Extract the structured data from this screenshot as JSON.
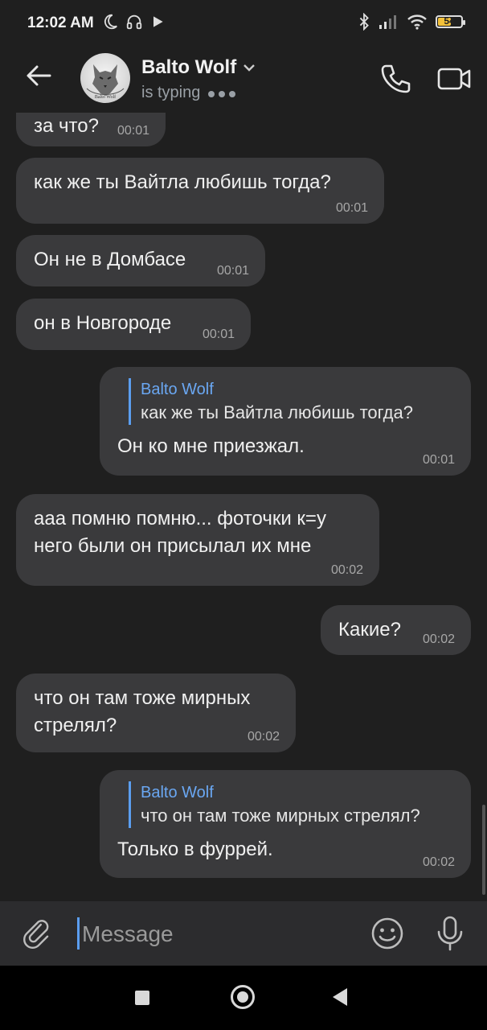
{
  "status_bar": {
    "time": "12:02 AM",
    "battery_level": "54",
    "battery_fraction": 0.54,
    "icons": [
      "moon-icon",
      "headphones-icon",
      "play-icon",
      "bluetooth-icon",
      "signal-icon",
      "wifi-icon",
      "battery-icon"
    ]
  },
  "header": {
    "contact_name": "Balto Wolf",
    "status": "is typing",
    "avatar_caption": "Balto Wolf"
  },
  "messages": [
    {
      "direction": "in",
      "text": "за что?",
      "time": "00:01"
    },
    {
      "direction": "in",
      "text": "как же ты Вайтла любишь тогда?",
      "time": "00:01"
    },
    {
      "direction": "in",
      "text": "Он не в Домбасе",
      "time": "00:01"
    },
    {
      "direction": "in",
      "text": "он в Новгороде",
      "time": "00:01"
    },
    {
      "direction": "out",
      "quote_name": "Balto Wolf",
      "quote_text": "как же ты Вайтла любишь тогда?",
      "text": "Он ко мне приезжал.",
      "time": "00:01"
    },
    {
      "direction": "in",
      "text": "ааа помню помню... фоточки к=у него были он присылал их мне",
      "time": "00:02"
    },
    {
      "direction": "out",
      "text": "Какие?",
      "time": "00:02"
    },
    {
      "direction": "in",
      "text": "что он там тоже мирных стрелял?",
      "time": "00:02"
    },
    {
      "direction": "out",
      "quote_name": "Balto Wolf",
      "quote_text": "что он там тоже мирных стрелял?",
      "text": "Только в фуррей.",
      "time": "00:02"
    }
  ],
  "input": {
    "placeholder": "Message"
  },
  "nav": {
    "icons": [
      "recents-square-icon",
      "home-circle-icon",
      "back-triangle-icon"
    ]
  }
}
